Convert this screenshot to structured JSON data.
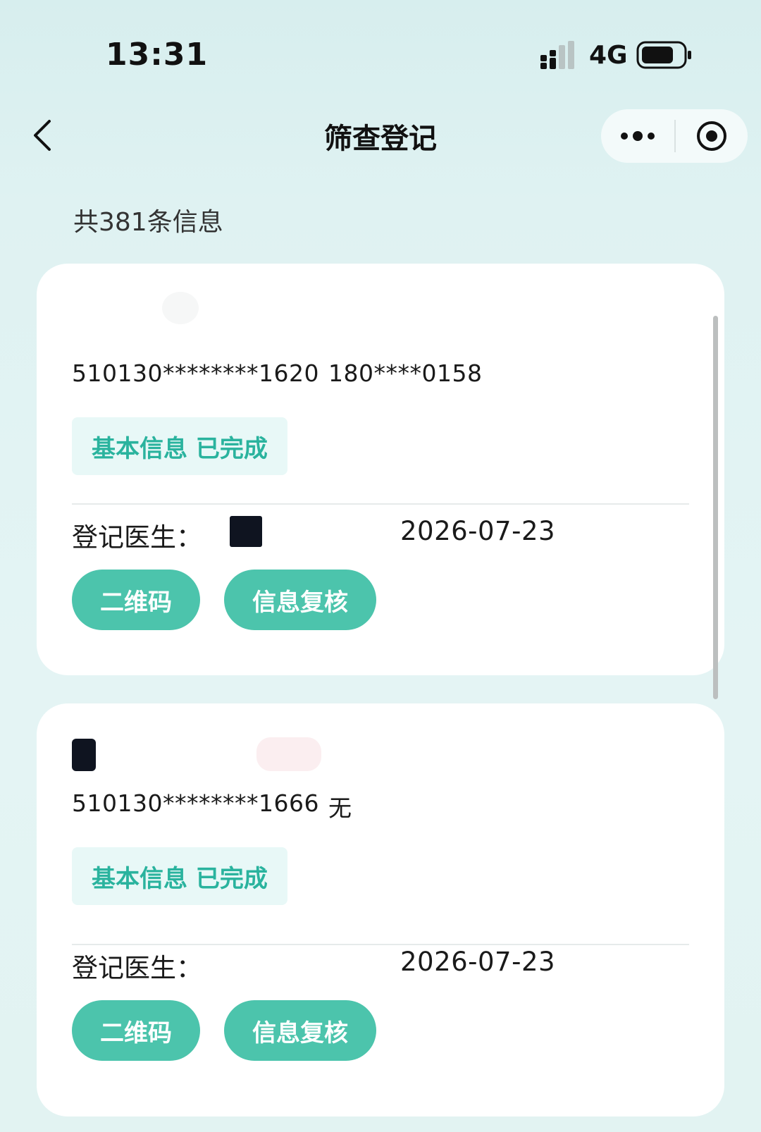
{
  "status_bar": {
    "time": "13:31",
    "network": "4G"
  },
  "nav": {
    "title": "筛查登记"
  },
  "list": {
    "total_label": "共381条信息",
    "cards": [
      {
        "id_number": "510130********1620",
        "phone": "180****0158",
        "status_tag": "基本信息 已完成",
        "doctor_label": "登记医生：",
        "date": "2026-07-23",
        "qr_button": "二维码",
        "review_button": "信息复核"
      },
      {
        "id_number": "510130********1666",
        "phone": "无",
        "status_tag": "基本信息 已完成",
        "doctor_label": "登记医生：",
        "date": "2026-07-23",
        "qr_button": "二维码",
        "review_button": "信息复核"
      }
    ]
  },
  "icons": {
    "back": "chevron-left-icon",
    "more": "more-dots-icon",
    "close": "target-circle-icon",
    "signal": "signal-icon",
    "battery": "battery-icon"
  },
  "colors": {
    "accent": "#4cc4ac",
    "tag_text": "#2ab39e",
    "tag_bg": "#e8f8f7",
    "background": "#dff2f2"
  }
}
